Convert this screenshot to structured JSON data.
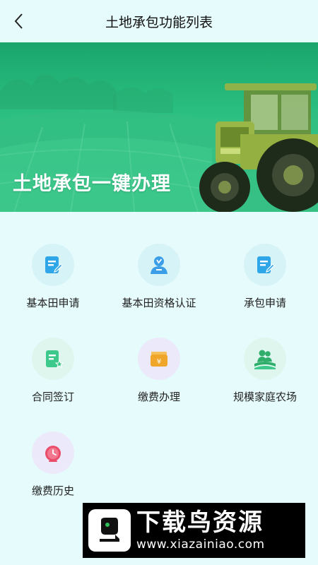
{
  "header": {
    "title": "土地承包功能列表",
    "back_icon": "back-arrow-icon"
  },
  "banner": {
    "text": "土地承包一键办理",
    "colors": {
      "top": "#1aa56c",
      "bottom": "#3dc78e"
    }
  },
  "functions": [
    {
      "label": "基本田申请",
      "icon": "document-edit-icon",
      "bg": "#d6f3f7",
      "color": "#2fa6e8"
    },
    {
      "label": "基本田资格认证",
      "icon": "user-verified-icon",
      "bg": "#d6f3f7",
      "color": "#3b9ee6"
    },
    {
      "label": "承包申请",
      "icon": "document-edit-icon",
      "bg": "#d6f3f7",
      "color": "#2fa6e8"
    },
    {
      "label": "合同签订",
      "icon": "contract-star-icon",
      "bg": "#dff6ef",
      "color": "#3cc98b"
    },
    {
      "label": "缴费办理",
      "icon": "wallet-yuan-icon",
      "bg": "#ece9fb",
      "color": "#f0a52b"
    },
    {
      "label": "规模家庭农场",
      "icon": "family-farm-icon",
      "bg": "#dff6ef",
      "color": "#2fae6b"
    },
    {
      "label": "缴费历史",
      "icon": "clock-history-icon",
      "bg": "#ece9fb",
      "color": "#ea4d6a"
    }
  ],
  "watermark": {
    "cn": "下载鸟资源",
    "url": "www.xiazainiao.com"
  }
}
